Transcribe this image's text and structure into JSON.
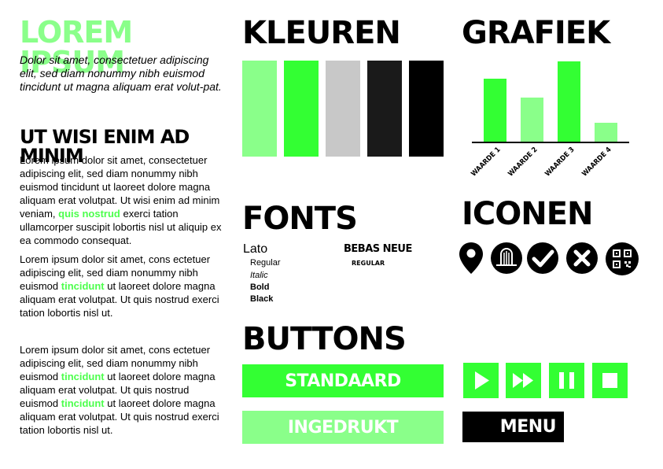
{
  "text_column": {
    "title": "LOREM IPSUM",
    "intro": "Dolor sit amet, consectetuer adipiscing elit, sed diam nonummy nibh euismod tincidunt ut magna aliquam erat volut-pat.",
    "subtitle": "UT WISI ENIM AD MINIM",
    "p1_a": "Lorem ipsum dolor sit amet, consectetuer adipiscing elit, sed diam nonummy nibh euismod tincidunt ut laoreet dolore magna aliquam erat volutpat. Ut wisi enim ad minim veniam, ",
    "p1_hl": "quis nostrud",
    "p1_b": " exerci tation ullamcorper suscipit lobortis nisl ut aliquip ex ea commodo consequat.",
    "p2_a": "Lorem ipsum dolor sit amet, cons ectetuer adipiscing elit, sed diam nonummy nibh euismod ",
    "p2_hl": "tincidunt",
    "p2_b": " ut laoreet dolore magna aliquam erat volutpat. Ut quis nostrud exerci tation lobortis nisl ut.",
    "p3_a": "Lorem ipsum dolor sit amet, cons ectetuer adipiscing elit, sed diam nonummy nibh euismod ",
    "p3_hl1": "tincidunt",
    "p3_b": " ut laoreet dolore magna aliquam erat volutpat. Ut quis nostrud euismod ",
    "p3_hl2": "tincidunt",
    "p3_c": " ut laoreet dolore magna aliquam erat volutpat. Ut quis nostrud exerci tation lobortis nisl ut."
  },
  "colors": {
    "title": "KLEUREN",
    "swatches": [
      "#8aff8a",
      "#33ff33",
      "#c8c8c8",
      "#1a1a1a",
      "#000000"
    ],
    "accent": "#4dff4d"
  },
  "chart": {
    "title": "GRAFIEK"
  },
  "chart_data": {
    "type": "bar",
    "categories": [
      "WAARDE 1",
      "WAARDE 2",
      "WAARDE 3",
      "WAARDE 4"
    ],
    "values": [
      80,
      56,
      102,
      24
    ],
    "colors": [
      "#33ff33",
      "#8aff8a",
      "#33ff33",
      "#8aff8a"
    ],
    "ylim": [
      0,
      110
    ],
    "title": "",
    "xlabel": "",
    "ylabel": "",
    "grid": false,
    "legend": "none"
  },
  "fonts": {
    "title": "FONTS",
    "lato": "Lato",
    "regular": "Regular",
    "italic": "Italic",
    "bold": "Bold",
    "black": "Black",
    "bebas": "BEBAS NEUE",
    "bebas_regular": "REGULAR"
  },
  "icons": {
    "title": "ICONEN",
    "items": [
      "location-pin-icon",
      "gate-icon",
      "check-icon",
      "close-icon",
      "qr-code-icon"
    ]
  },
  "buttons": {
    "title": "BUTTONS",
    "standard": "STANDAARD",
    "pressed": "INGEDRUKT",
    "menu": "MENU",
    "controls": [
      "play-icon",
      "fast-forward-icon",
      "pause-icon",
      "stop-icon"
    ]
  }
}
